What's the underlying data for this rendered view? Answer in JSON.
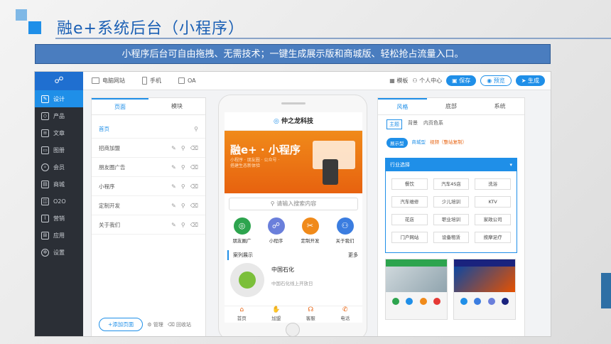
{
  "slide": {
    "title": "融e+系统后台（小程序）",
    "banner_text": "小程序后台可自由拖拽、无需技术；一键生成展示版和商城版、轻松抢占流量入口。"
  },
  "sidebar": {
    "logo": "☍",
    "items": [
      {
        "label": "设计",
        "icon": "palette-icon",
        "active": true
      },
      {
        "label": "产品",
        "icon": "cube-icon"
      },
      {
        "label": "文章",
        "icon": "article-icon"
      },
      {
        "label": "图册",
        "icon": "image-icon"
      },
      {
        "label": "会员",
        "icon": "user-icon"
      },
      {
        "label": "商城",
        "icon": "shop-icon"
      },
      {
        "label": "O2O",
        "icon": "o2o-icon"
      },
      {
        "label": "营销",
        "icon": "chart-icon"
      },
      {
        "label": "应用",
        "icon": "apps-icon"
      },
      {
        "label": "设置",
        "icon": "gear-icon"
      }
    ]
  },
  "topbar": {
    "tabs": [
      "电脑网站",
      "手机",
      "OA"
    ],
    "template": "模板",
    "personal": "个人中心",
    "save": "保存",
    "preview": "预览",
    "generate": "生成"
  },
  "left_panel": {
    "tabs": [
      "页面",
      "模块"
    ],
    "pages": [
      "首页",
      "招商加盟",
      "朋友圈广告",
      "小程序",
      "定制开发",
      "关于我们"
    ],
    "add_page": "+添加页面",
    "manage": "管理",
    "recycle": "回收站"
  },
  "phone": {
    "brand": "仲之龙科技",
    "banner_title": "融e+ · 小程序",
    "banner_sub": "小程序 · 朋友圈 · 公众号 · 搭建生态新体验",
    "search_placeholder": "请输入搜索内容",
    "icons": [
      {
        "label": "朋友圈广",
        "color": "#2da44e"
      },
      {
        "label": "小程序",
        "color": "#6a7fdb"
      },
      {
        "label": "定制开发",
        "color": "#f08a1a"
      },
      {
        "label": "关于我们",
        "color": "#3b7de0"
      }
    ],
    "case_title": "案列展示",
    "case_more": "更多",
    "case_item_title": "中国石化",
    "case_item_sub": "中国石化线上开放日",
    "nav": [
      "首页",
      "加盟",
      "客服",
      "电话"
    ]
  },
  "right_panel": {
    "tabs": [
      "风格",
      "底部",
      "系统"
    ],
    "subtabs": [
      "主题",
      "背景",
      "内页色系"
    ],
    "pills": [
      "展示型",
      "商城型",
      "视频（整站复制）"
    ],
    "industry_label": "行业选择",
    "industries": [
      "餐饮",
      "汽车4S店",
      "洗浴",
      "汽车维修",
      "少儿培训",
      "KTV",
      "花店",
      "职业培训",
      "家政公司",
      "门户网站",
      "设备租赁",
      "按摩足疗"
    ]
  }
}
